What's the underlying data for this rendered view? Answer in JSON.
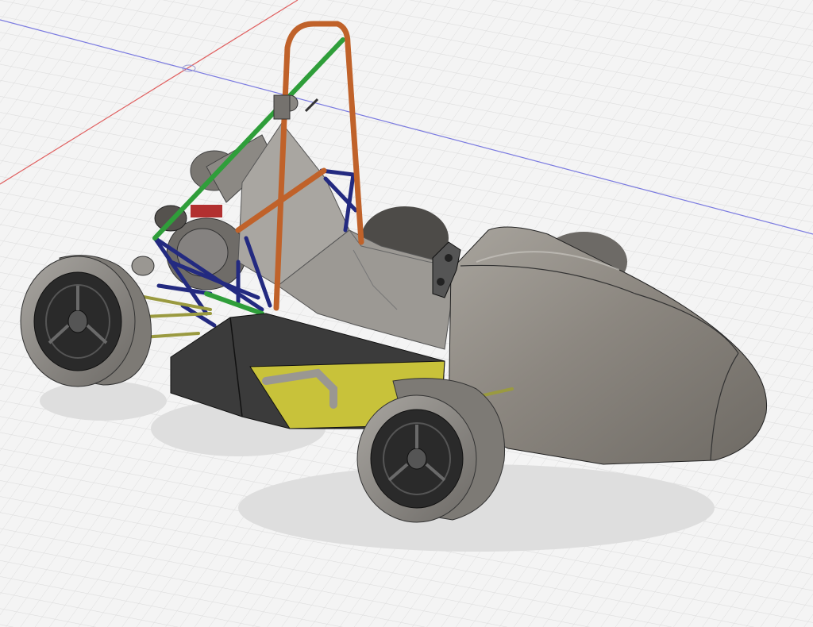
{
  "viewport": {
    "background": "#f4f4f4",
    "grid_minor_color": "#dcdcdc",
    "grid_major_color": "#c8c8c8",
    "x_axis_color": "#e06060",
    "y_axis_color": "#7a7ae0"
  },
  "model": {
    "body_color": "#8c8780",
    "body_highlight": "#b9b5ae",
    "sidepod_color": "#3b3b3b",
    "tire_color": "#8d8a85",
    "rim_color": "#2a2a2a",
    "main_hoop_color": "#c0622a",
    "brace_color": "#2f9e3a",
    "frame_color": "#232a80",
    "suspension_color": "#9a9a40",
    "radiator_color": "#c8c23a",
    "engine_color": "#6f6c68",
    "firewall_color": "#a9a6a1",
    "shadow_color": "#dcdcdc"
  }
}
